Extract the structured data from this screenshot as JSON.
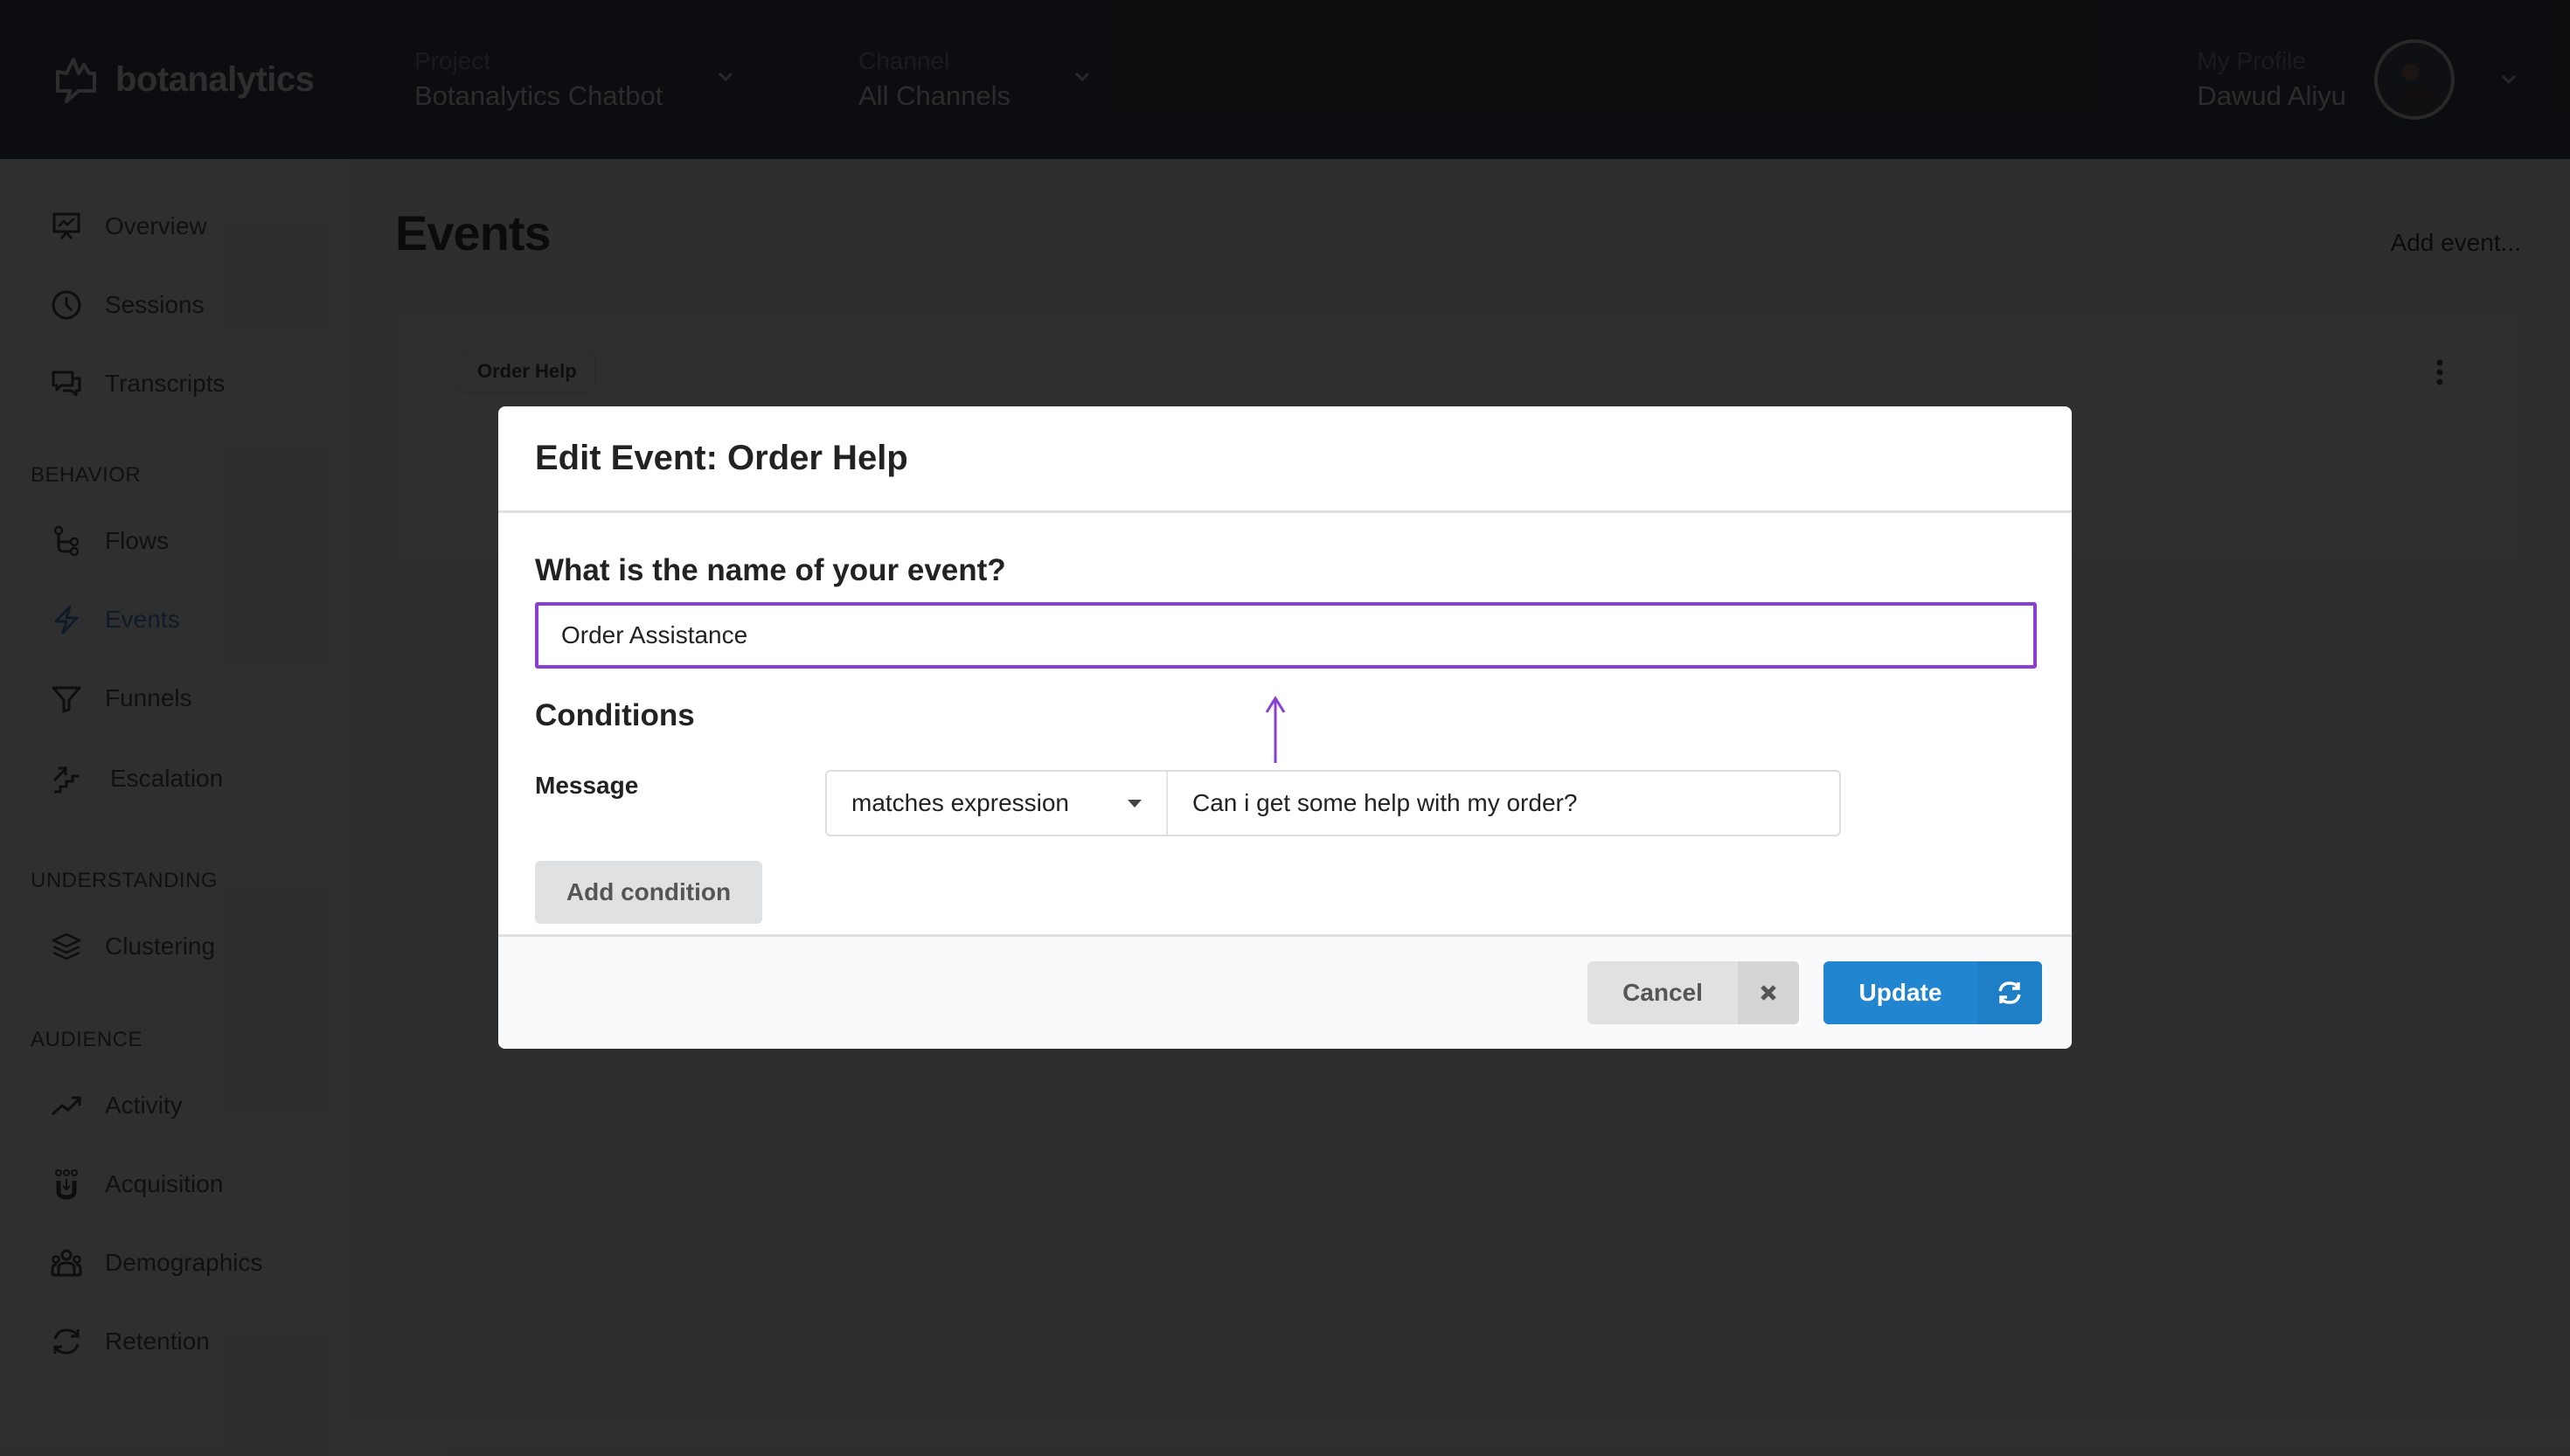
{
  "app": {
    "brand_name": "botanalytics",
    "project": {
      "label": "Project",
      "value": "Botanalytics Chatbot"
    },
    "channel": {
      "label": "Channel",
      "value": "All Channels"
    },
    "profile": {
      "label": "My Profile",
      "name": "Dawud Aliyu"
    }
  },
  "sidebar": {
    "items": [
      {
        "label": "Overview",
        "icon": "presentation-chart-icon"
      },
      {
        "label": "Sessions",
        "icon": "clock-icon"
      },
      {
        "label": "Transcripts",
        "icon": "chat-bubbles-icon"
      },
      {
        "label": "Flows",
        "icon": "flow-branch-icon"
      },
      {
        "label": "Events",
        "icon": "lightning-icon",
        "active": true
      },
      {
        "label": "Funnels",
        "icon": "funnel-icon"
      },
      {
        "label": "Escalation",
        "icon": "escalation-stairs-icon"
      },
      {
        "label": "Clustering",
        "icon": "layers-icon"
      },
      {
        "label": "Activity",
        "icon": "trend-up-icon"
      },
      {
        "label": "Acquisition",
        "icon": "magnet-users-icon"
      },
      {
        "label": "Demographics",
        "icon": "users-group-icon"
      },
      {
        "label": "Retention",
        "icon": "refresh-icon"
      }
    ],
    "sections": [
      "BEHAVIOR",
      "UNDERSTANDING",
      "AUDIENCE"
    ]
  },
  "main": {
    "title": "Events",
    "add_event_label": "Add event...",
    "event_chip": "Order Help"
  },
  "modal": {
    "title": "Edit Event: Order Help",
    "name_question": "What is the name of your event?",
    "name_value": "Order Assistance",
    "conditions_title": "Conditions",
    "condition": {
      "field_label": "Message",
      "operator": "matches expression",
      "value": "Can i get some help with my order?"
    },
    "add_condition_label": "Add condition",
    "cancel_label": "Cancel",
    "update_label": "Update"
  },
  "colors": {
    "accent_purple": "#8a3fd1",
    "primary_blue": "#2185d0",
    "active_nav": "#2a7bd1"
  }
}
